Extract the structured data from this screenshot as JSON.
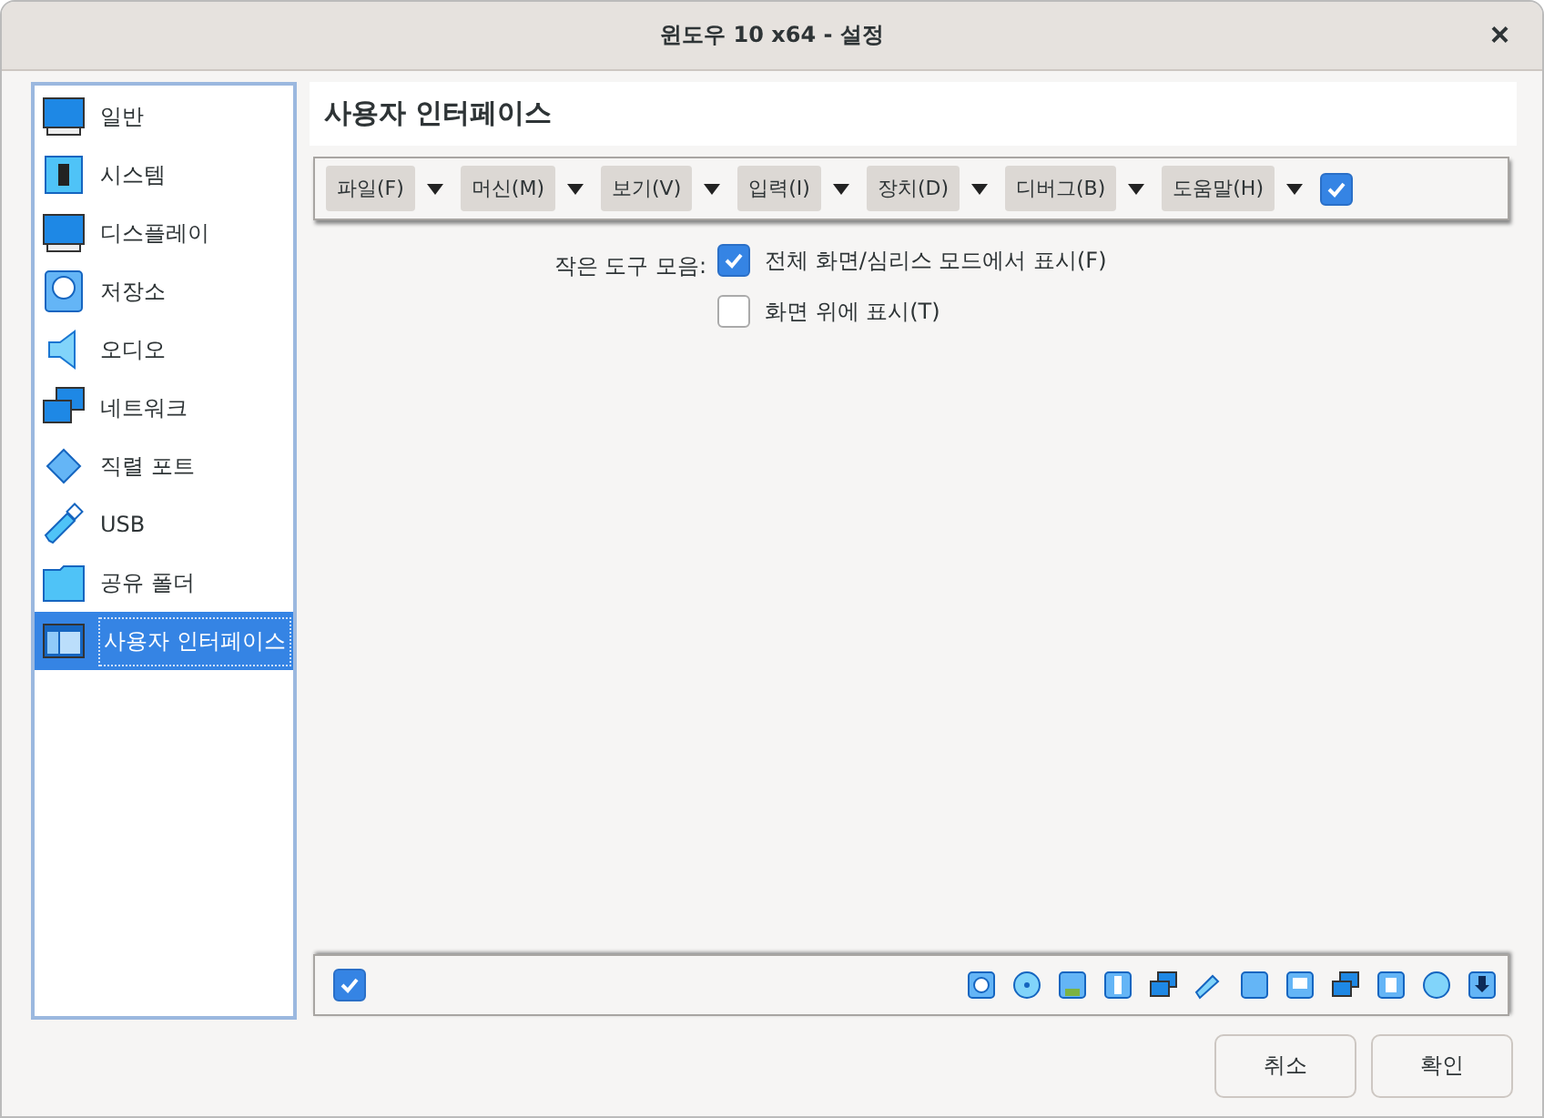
{
  "window": {
    "title": "윈도우 10 x64 - 설정",
    "close": "×"
  },
  "sidebar": {
    "items": [
      {
        "label": "일반",
        "selected": false
      },
      {
        "label": "시스템",
        "selected": false
      },
      {
        "label": "디스플레이",
        "selected": false
      },
      {
        "label": "저장소",
        "selected": false
      },
      {
        "label": "오디오",
        "selected": false
      },
      {
        "label": "네트워크",
        "selected": false
      },
      {
        "label": "직렬 포트",
        "selected": false
      },
      {
        "label": "USB",
        "selected": false
      },
      {
        "label": "공유 폴더",
        "selected": false
      },
      {
        "label": "사용자 인터페이스",
        "selected": true
      }
    ]
  },
  "page": {
    "title": "사용자 인터페이스",
    "menu_bar": {
      "enabled": true,
      "menus": [
        "파일(F)",
        "머신(M)",
        "보기(V)",
        "입력(I)",
        "장치(D)",
        "디버그(B)",
        "도움말(H)"
      ]
    },
    "mini_toolbar": {
      "label": "작은 도구 모음:",
      "options": [
        {
          "label": "전체 화면/심리스 모드에서 표시(F)",
          "checked": true
        },
        {
          "label": "화면 위에 표시(T)",
          "checked": false
        }
      ]
    },
    "status_bar": {
      "enabled": true
    }
  },
  "buttons": [
    "취소",
    "확인"
  ]
}
